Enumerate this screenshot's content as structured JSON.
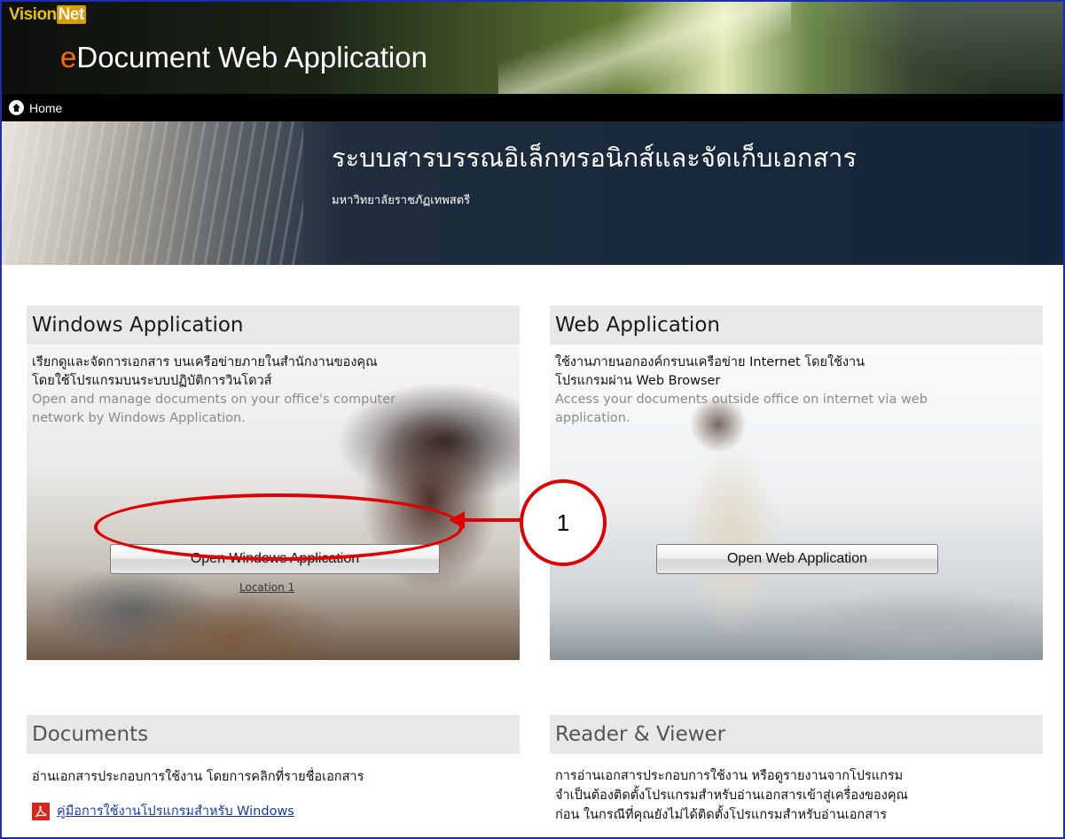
{
  "header": {
    "logo_vision": "Vision",
    "logo_net": "Net",
    "title_prefix": "e",
    "title_rest": "Document Web Application"
  },
  "nav": {
    "home_label": "Home"
  },
  "hero": {
    "title": "ระบบสารบรรณอิเล็กทรอนิกส์และจัดเก็บเอกสาร",
    "subtitle": "มหาวิทยาลัยราชภัฏเทพสตรี"
  },
  "windows_panel": {
    "heading": "Windows Application",
    "desc_th_1": "เรียกดูและจัดการเอกสาร บนเครือข่ายภายในสำนักงานของคุณ",
    "desc_th_2": "โดยใช้โปรแกรมบนระบบปฏิบัติการวินโดวส์",
    "desc_en_1": "Open and manage documents on your office's computer",
    "desc_en_2": "network by Windows Application.",
    "button_label": "Open Windows Application",
    "location_link": "Location 1"
  },
  "web_panel": {
    "heading": "Web Application",
    "desc_th_1": "ใช้งานภายนอกองค์กรบนเครือข่าย Internet โดยใช้งาน",
    "desc_th_2": "โปรแกรมผ่าน Web Browser",
    "desc_en_1": "Access your documents outside office on internet via web",
    "desc_en_2": "application.",
    "button_label": "Open Web Application"
  },
  "annotation": {
    "marker_number": "1",
    "color": "#e00000"
  },
  "documents_panel": {
    "heading": "Documents",
    "description": "อ่านเอกสารประกอบการใช้งาน โดยการคลิกที่รายชื่อเอกสาร",
    "items": [
      {
        "label": "คู่มือการใช้งานโปรแกรมสำหรับ Windows",
        "icon": "pdf-icon"
      }
    ]
  },
  "reader_panel": {
    "heading": "Reader & Viewer",
    "line_1": "การอ่านเอกสารประกอบการใช้งาน หรือดูรายงานจากโปรแกรม",
    "line_2": "จำเป็นต้องติดตั้งโปรแกรมสำหรับอ่านเอกสารเข้าสู่เครื่องของคุณ",
    "line_3": "ก่อน ในกรณีที่คุณยังไม่ได้ติดตั้งโปรแกรมสำหรับอ่านเอกสาร"
  }
}
